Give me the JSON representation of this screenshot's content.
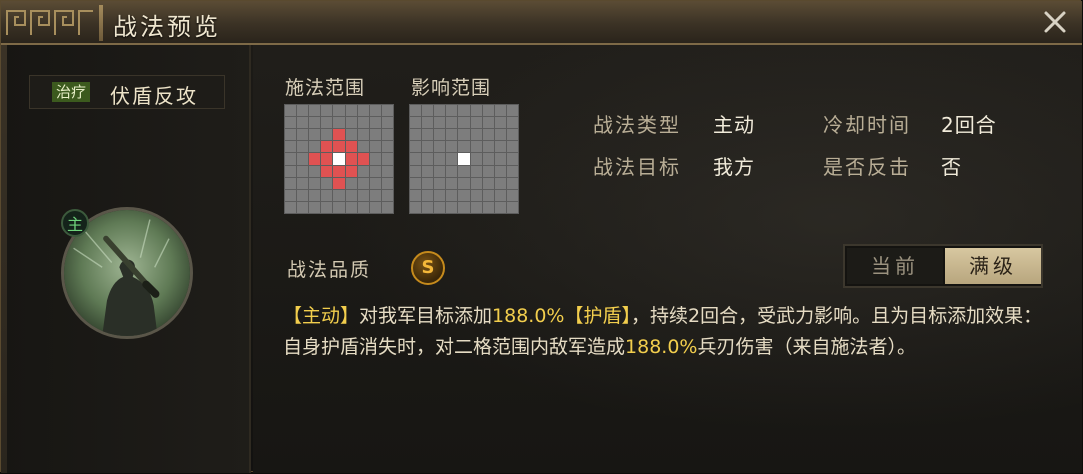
{
  "header": {
    "title": "战法预览"
  },
  "skill": {
    "type_badge": "治疗",
    "name": "伏盾反攻",
    "active_marker": "主"
  },
  "grids": {
    "cast_label": "施法范围",
    "effect_label": "影响范围"
  },
  "info": {
    "type_label": "战法类型",
    "type_value": "主动",
    "cooldown_label": "冷却时间",
    "cooldown_value": "2回合",
    "target_label": "战法目标",
    "target_value": "我方",
    "counter_label": "是否反击",
    "counter_value": "否"
  },
  "quality": {
    "label": "战法品质",
    "grade": "S"
  },
  "toggle": {
    "current_label": "当前",
    "max_label": "满级",
    "selected": "满级"
  },
  "description": {
    "tag1": "【主动】",
    "seg1": "对我军目标添加",
    "val1": "188.0%",
    "tag2": "【护盾】",
    "seg2": "，持续2回合，受武力影响。且为目标添加效果：自身护盾消失时，对二格范围内敌军造成",
    "val2": "188.0%",
    "seg3": "兵刃伤害（来自施法者）。"
  },
  "colors": {
    "highlight": "#f2ce4d",
    "range_cell": "#e05252",
    "center_cell": "#ffffff",
    "grid_cell": "#7d7d7d",
    "active_marker": "#6fd47c",
    "quality": "#f5b83a"
  }
}
